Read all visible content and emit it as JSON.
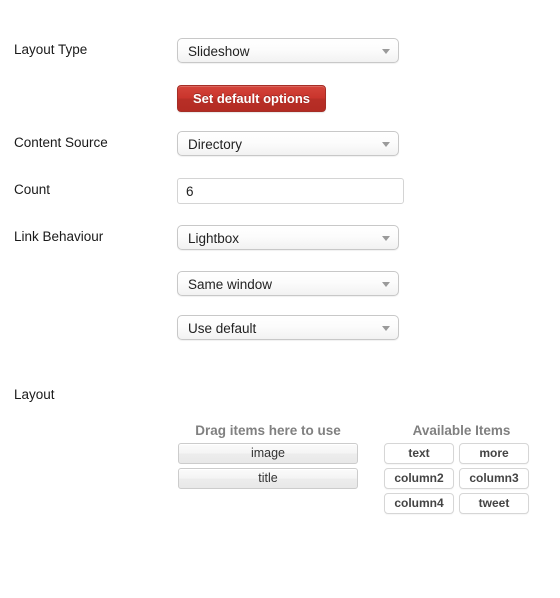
{
  "form": {
    "rows": [
      {
        "label": "Layout Type",
        "control": "select",
        "value": "Slideshow"
      },
      {
        "label": "",
        "control": "button",
        "value": "Set default options"
      },
      {
        "label": "Content Source",
        "control": "select",
        "value": "Directory"
      },
      {
        "label": "Count",
        "control": "input",
        "value": "6",
        "placeholder": ""
      },
      {
        "label": "Link Behaviour",
        "control": "select",
        "value": "Lightbox"
      },
      {
        "label": "",
        "control": "select",
        "value": "Same window"
      },
      {
        "label": "",
        "control": "select",
        "value": "Use default"
      }
    ]
  },
  "layout_section": {
    "label": "Layout",
    "dropzone": {
      "heading": "Drag items here to use",
      "items": [
        "image",
        "title"
      ]
    },
    "available": {
      "heading": "Available Items",
      "items": [
        "text",
        "more",
        "column2",
        "column3",
        "column4",
        "tweet"
      ]
    }
  },
  "icons": {
    "dropdown_caret": "chevron-down-icon"
  },
  "colors": {
    "primary_button": "#c9342c",
    "primary_button_border": "#a52e26",
    "heading_gray": "#808080",
    "control_border": "#c8c8c8",
    "page_background": "#ffffff"
  }
}
